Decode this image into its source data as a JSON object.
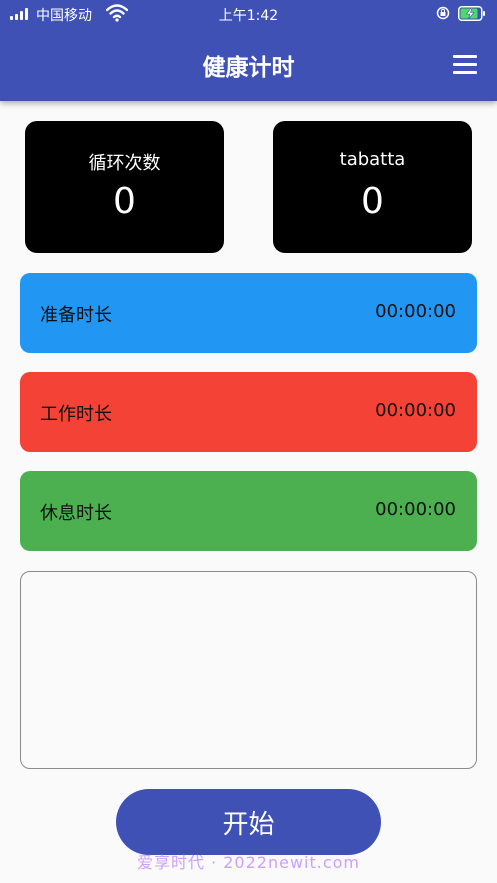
{
  "status_bar": {
    "carrier": "中国移动",
    "time": "上午1:42"
  },
  "app_bar": {
    "title": "健康计时"
  },
  "counters": [
    {
      "label": "循环次数",
      "value": "0"
    },
    {
      "label": "tabatta",
      "value": "0"
    }
  ],
  "durations": [
    {
      "label": "准备时长",
      "time": "00:00:00",
      "color": "#2196f3"
    },
    {
      "label": "工作时长",
      "time": "00:00:00",
      "color": "#f44336"
    },
    {
      "label": "休息时长",
      "time": "00:00:00",
      "color": "#4caf50"
    }
  ],
  "start_button": {
    "label": "开始"
  },
  "watermark": "爱享时代 · 2022newit.com",
  "colors": {
    "primary": "#3f51b5",
    "counter_bg": "#000000"
  },
  "icons": [
    "signal-icon",
    "wifi-icon",
    "lock-rotation-icon",
    "battery-charging-icon",
    "menu-icon"
  ]
}
